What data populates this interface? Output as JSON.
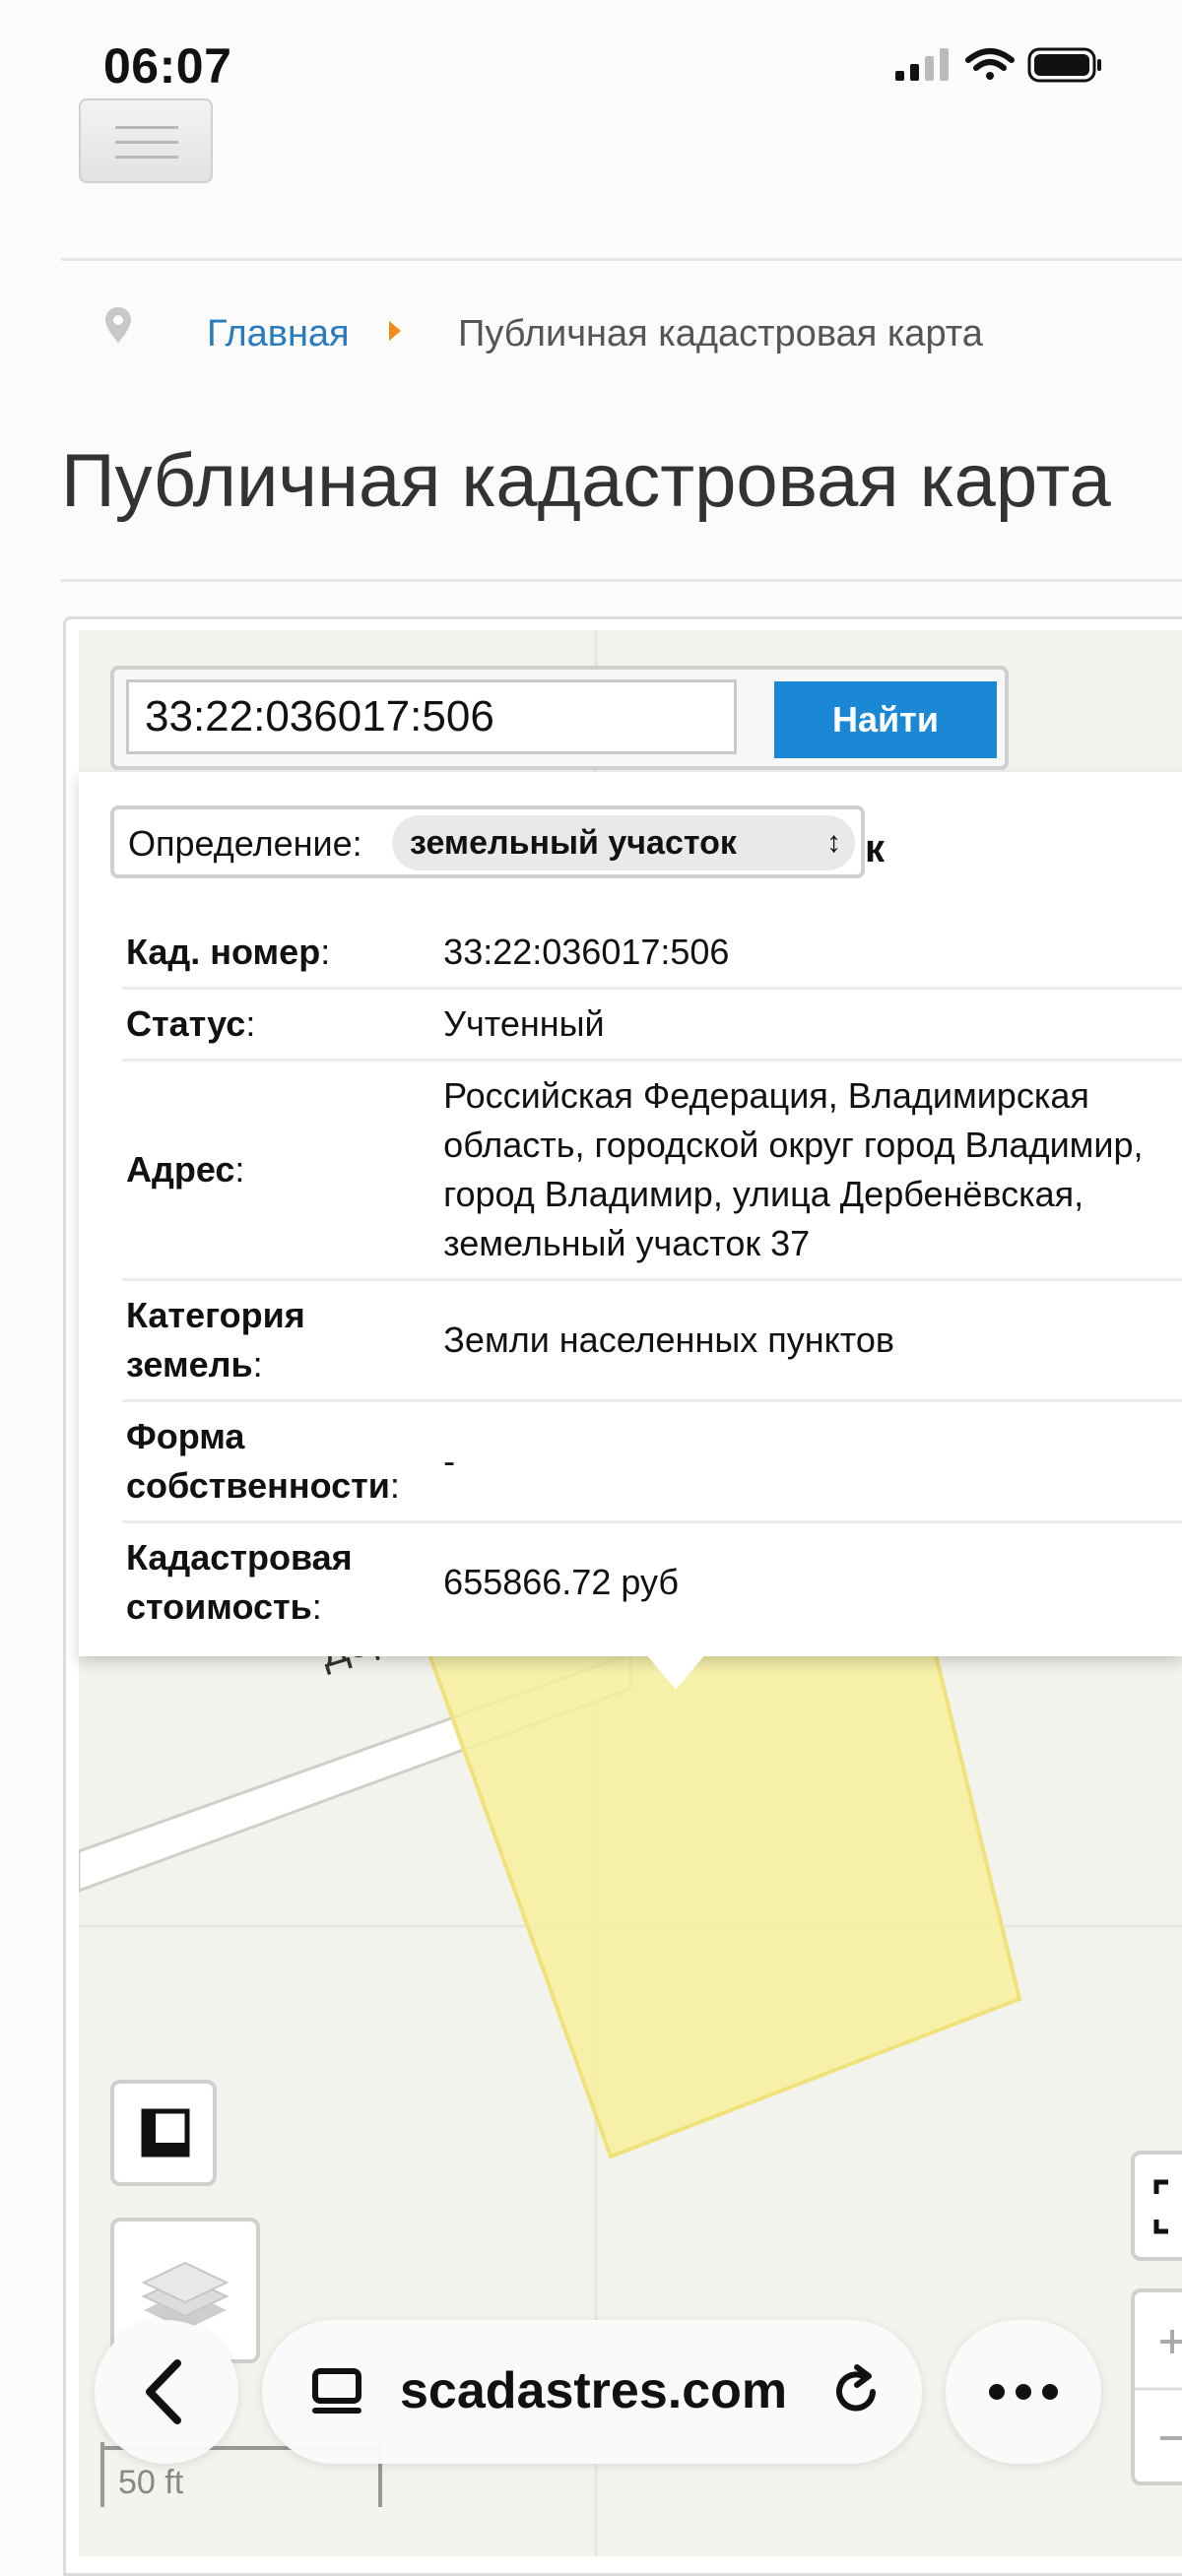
{
  "status_bar": {
    "time": "06:07"
  },
  "breadcrumb": {
    "home": "Главная",
    "current": "Публичная кадастровая карта"
  },
  "page": {
    "title": "Публичная кадастровая карта"
  },
  "search": {
    "value": "33:22:036017:506",
    "button_label": "Найти"
  },
  "definition": {
    "label": "Определение:",
    "selected": "земельный участок",
    "hidden_suffix": "к"
  },
  "attributes": [
    {
      "key": "Кад. номер",
      "value": "33:22:036017:506"
    },
    {
      "key": "Статус",
      "value": "Учтенный"
    },
    {
      "key": "Адрес",
      "value": "Российская Федерация, Владимирская область, городской округ город Владимир, город Владимир, улица Дербенёвская, земельный участок 37"
    },
    {
      "key": "Категория земель",
      "value": "Земли населенных пунктов"
    },
    {
      "key": "Форма собственности",
      "value": "-"
    },
    {
      "key": "Кадастровая стоимость",
      "value": "655866.72 руб"
    }
  ],
  "map": {
    "street_label": "Дербенёвская ул.",
    "scale_label": "50 ft",
    "parcel_color": "#f6ef9c"
  },
  "browser": {
    "url": "scadastres.com"
  }
}
